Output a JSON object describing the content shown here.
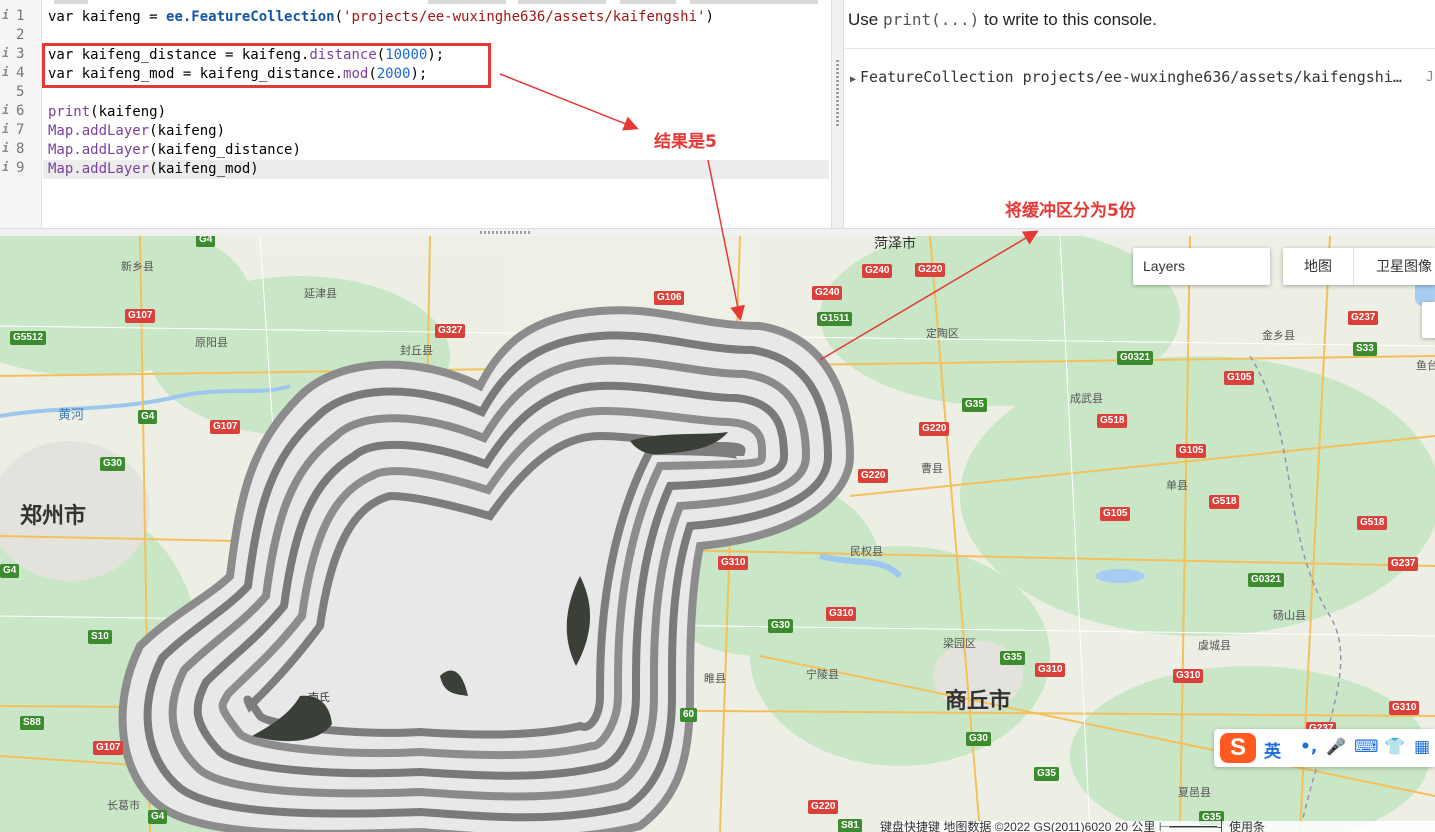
{
  "editor": {
    "lines": [
      {
        "num": "1",
        "has_info": true
      },
      {
        "num": "2",
        "has_info": false
      },
      {
        "num": "3",
        "has_info": true
      },
      {
        "num": "4",
        "has_info": true
      },
      {
        "num": "5",
        "has_info": false
      },
      {
        "num": "6",
        "has_info": true
      },
      {
        "num": "7",
        "has_info": true
      },
      {
        "num": "8",
        "has_info": true
      },
      {
        "num": "9",
        "has_info": true
      }
    ],
    "info_glyph": "i",
    "code": {
      "l1": {
        "kw": "var",
        "name": " kaifeng = ",
        "obj": "ee.FeatureCollection",
        "open": "(",
        "str": "'projects/ee-wuxinghe636/assets/kaifengshi'",
        "close": ")"
      },
      "l3": {
        "kw": "var",
        "name": " kaifeng_distance = kaifeng.",
        "fn": "distance",
        "open": "(",
        "num": "10000",
        "close": ");"
      },
      "l4": {
        "kw": "var",
        "name": " kaifeng_mod = kaifeng_distance.",
        "fn": "mod",
        "open": "(",
        "num": "2000",
        "close": ");"
      },
      "l6": {
        "fn": "print",
        "rest": "(kaifeng)"
      },
      "l7": {
        "fn": "Map.addLayer",
        "rest": "(kaifeng)"
      },
      "l8": {
        "fn": "Map.addLayer",
        "rest": "(kaifeng_distance)"
      },
      "l9": {
        "fn": "Map.addLayer",
        "rest": "(kaifeng_mod)"
      }
    }
  },
  "console": {
    "hint_prefix": "Use ",
    "hint_code": "print(...)",
    "hint_suffix": " to write to this console.",
    "output": "FeatureCollection projects/ee-wuxinghe636/assets/kaifengshi…",
    "json_label": "J"
  },
  "annotations": {
    "result": "结果是5",
    "buffer": "将缓冲区分为5份",
    "color": "#e53935"
  },
  "map": {
    "layers_label": "Layers",
    "maptype_map": "地图",
    "maptype_satellite": "卫星图像",
    "cities_big": [
      "郑州市",
      "商丘市"
    ],
    "city_heze": "菏泽市",
    "cities_small": [
      "新乡县",
      "延津县",
      "原阳县",
      "封丘县",
      "定陶区",
      "成武县",
      "金乡县",
      "鱼台",
      "曹县",
      "单县",
      "民权县",
      "宁陵县",
      "梁园区",
      "虞城县",
      "砀山县",
      "睢县",
      "夏邑县",
      "长葛市",
      "黄河",
      "南氏"
    ],
    "shields_red": [
      "G107",
      "G327",
      "G106",
      "G240",
      "G220",
      "G240",
      "G237",
      "G105",
      "G107",
      "G220",
      "G220",
      "G518",
      "G105",
      "G105",
      "G518",
      "G518",
      "G237",
      "G310",
      "G310",
      "G310",
      "G310",
      "G310",
      "G237",
      "G107",
      "G220"
    ],
    "shields_green": [
      "G5512",
      "G4",
      "G4",
      "G30",
      "G1511",
      "G0321",
      "S33",
      "G35",
      "G0321",
      "S10",
      "G30",
      "S88",
      "G4",
      "S81",
      "G35",
      "G30",
      "G35",
      "G35",
      "G4",
      "60"
    ],
    "attribution": "键盘快捷键    地图数据 ©2022 GS(2011)6020   20 公里  ⊢━━━━┤    使用条"
  },
  "ime": {
    "logo": "S",
    "lang": "英",
    "punct": "•,"
  },
  "colors": {
    "editor_bg": "#ffffff",
    "highlight_box": "#e53935",
    "map_land": "#e9eddf",
    "map_green": "#bfe3c0",
    "road_major": "#f5c35b",
    "buffer_dark": "#2b2b2b"
  }
}
